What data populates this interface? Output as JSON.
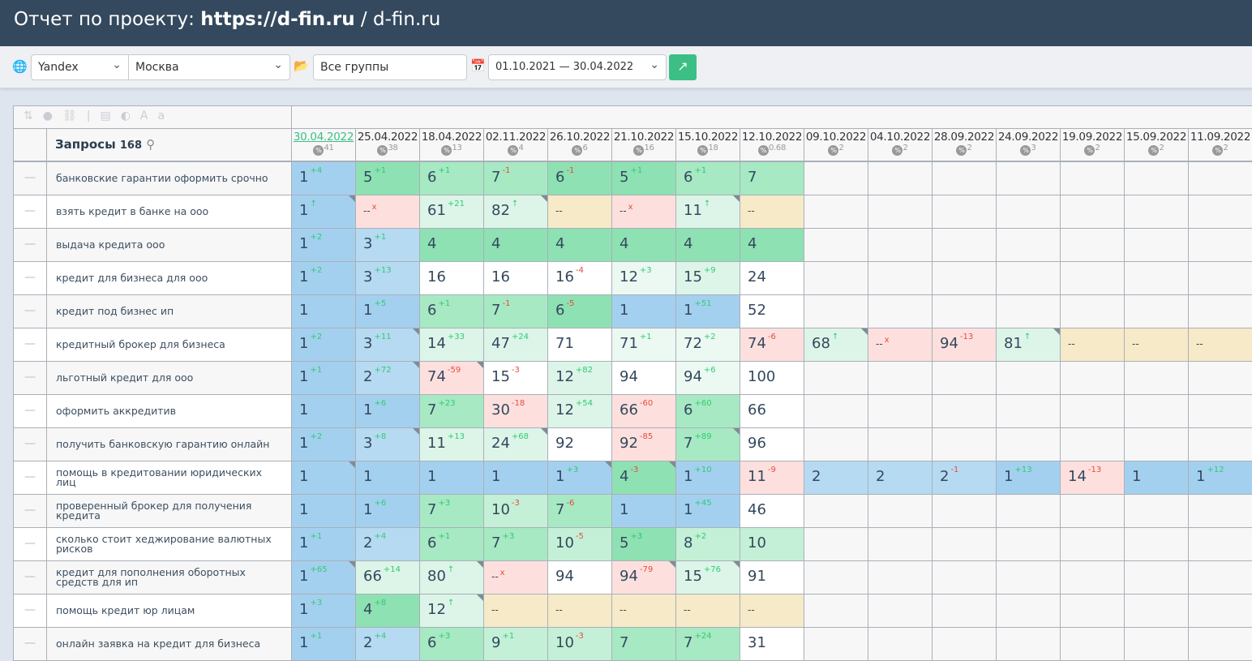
{
  "header": {
    "prefix": "Отчет по проекту: ",
    "project": "https://d-fin.ru",
    "suffix": " / d-fin.ru"
  },
  "filters": {
    "engine": "Yandex",
    "region": "Москва",
    "group": "Все группы",
    "date_range": "01.10.2021 — 30.04.2022"
  },
  "table": {
    "queries_label": "Запросы",
    "queries_count": "168",
    "dates": [
      {
        "date": "30.04.2022",
        "pct": "41"
      },
      {
        "date": "25.04.2022",
        "pct": "38"
      },
      {
        "date": "18.04.2022",
        "pct": "13"
      },
      {
        "date": "02.11.2022",
        "pct": "4"
      },
      {
        "date": "26.10.2022",
        "pct": "6"
      },
      {
        "date": "21.10.2022",
        "pct": "16"
      },
      {
        "date": "15.10.2022",
        "pct": "18"
      },
      {
        "date": "12.10.2022",
        "pct": "0.68"
      },
      {
        "date": "09.10.2022",
        "pct": "2"
      },
      {
        "date": "04.10.2022",
        "pct": "2"
      },
      {
        "date": "28.09.2022",
        "pct": "2"
      },
      {
        "date": "24.09.2022",
        "pct": "3"
      },
      {
        "date": "19.09.2022",
        "pct": "2"
      },
      {
        "date": "15.09.2022",
        "pct": "2"
      },
      {
        "date": "11.09.2022",
        "pct": "2"
      }
    ],
    "rows": [
      {
        "q": "банковские гарантии оформить срочно",
        "cells": [
          [
            "1",
            "+4",
            "b"
          ],
          [
            "5",
            "+1",
            "g1"
          ],
          [
            "6",
            "+1",
            "g2"
          ],
          [
            "7",
            "-1",
            "g2"
          ],
          [
            "6",
            "-1",
            "g1"
          ],
          [
            "5",
            "+1",
            "g1"
          ],
          [
            "6",
            "+1",
            "g2"
          ],
          [
            "7",
            "",
            "g2"
          ]
        ]
      },
      {
        "q": "взять кредит в банке на ооо",
        "cells": [
          [
            "1",
            "up",
            "b",
            1
          ],
          [
            "--",
            "x",
            "p"
          ],
          [
            "61",
            "+21",
            "g4"
          ],
          [
            "82",
            "up",
            "g4",
            1
          ],
          [
            "--",
            "",
            "y"
          ],
          [
            "--",
            "x",
            "p"
          ],
          [
            "11",
            "up",
            "g4",
            1
          ],
          [
            "--",
            "",
            "y"
          ]
        ]
      },
      {
        "q": "выдача кредита ооо",
        "cells": [
          [
            "1",
            "+2",
            "b"
          ],
          [
            "3",
            "+1",
            "lb"
          ],
          [
            "4",
            "",
            "g1"
          ],
          [
            "4",
            "",
            "g1"
          ],
          [
            "4",
            "",
            "g1"
          ],
          [
            "4",
            "",
            "g1"
          ],
          [
            "4",
            "",
            "g1"
          ],
          [
            "4",
            "",
            "g1"
          ]
        ]
      },
      {
        "q": "кредит для бизнеса для ооо",
        "cells": [
          [
            "1",
            "+2",
            "b"
          ],
          [
            "3",
            "+13",
            "lb"
          ],
          [
            "16",
            "",
            "w"
          ],
          [
            "16",
            "",
            "w"
          ],
          [
            "16",
            "-4",
            "w"
          ],
          [
            "12",
            "+3",
            "g5"
          ],
          [
            "15",
            "+9",
            "g4"
          ],
          [
            "24",
            "",
            "w"
          ]
        ]
      },
      {
        "q": "кредит под бизнес ип",
        "cells": [
          [
            "1",
            "",
            "b"
          ],
          [
            "1",
            "+5",
            "b"
          ],
          [
            "6",
            "+1",
            "g2"
          ],
          [
            "7",
            "-1",
            "g2"
          ],
          [
            "6",
            "-5",
            "g1"
          ],
          [
            "1",
            "",
            "b"
          ],
          [
            "1",
            "+51",
            "b"
          ],
          [
            "52",
            "",
            "w"
          ]
        ]
      },
      {
        "q": "кредитный брокер для бизнеса",
        "cells": [
          [
            "1",
            "+2",
            "b"
          ],
          [
            "3",
            "+11",
            "lb",
            1
          ],
          [
            "14",
            "+33",
            "g4"
          ],
          [
            "47",
            "+24",
            "g4"
          ],
          [
            "71",
            "",
            "w"
          ],
          [
            "71",
            "+1",
            "g5"
          ],
          [
            "72",
            "+2",
            "g5"
          ],
          [
            "74",
            "-6",
            "p"
          ],
          [
            "68",
            "up",
            "g4",
            1
          ],
          [
            "--",
            "x",
            "p"
          ],
          [
            "94",
            "-13",
            "p"
          ],
          [
            "81",
            "up",
            "g4",
            1
          ],
          [
            "--",
            "",
            "y"
          ],
          [
            "--",
            "",
            "y"
          ],
          [
            "--",
            "",
            "y"
          ]
        ]
      },
      {
        "q": "льготный кредит для ооо",
        "cells": [
          [
            "1",
            "+1",
            "b"
          ],
          [
            "2",
            "+72",
            "lb",
            1
          ],
          [
            "74",
            "-59",
            "p",
            1
          ],
          [
            "15",
            "-3",
            "w"
          ],
          [
            "12",
            "+82",
            "g4"
          ],
          [
            "94",
            "",
            "w"
          ],
          [
            "94",
            "+6",
            "g5"
          ],
          [
            "100",
            "",
            "w"
          ]
        ]
      },
      {
        "q": "оформить аккредитив",
        "cells": [
          [
            "1",
            "",
            "b"
          ],
          [
            "1",
            "+6",
            "b"
          ],
          [
            "7",
            "+23",
            "g2"
          ],
          [
            "30",
            "-18",
            "p"
          ],
          [
            "12",
            "+54",
            "g4"
          ],
          [
            "66",
            "-60",
            "p"
          ],
          [
            "6",
            "+60",
            "g2"
          ],
          [
            "66",
            "",
            "w"
          ]
        ]
      },
      {
        "q": "получить банковскую гарантию онлайн",
        "cells": [
          [
            "1",
            "+2",
            "b"
          ],
          [
            "3",
            "+8",
            "lb",
            1
          ],
          [
            "11",
            "+13",
            "g4"
          ],
          [
            "24",
            "+68",
            "g4",
            1
          ],
          [
            "92",
            "",
            "w"
          ],
          [
            "92",
            "-85",
            "p"
          ],
          [
            "7",
            "+89",
            "g2",
            1
          ],
          [
            "96",
            "",
            "w"
          ]
        ]
      },
      {
        "q": "помощь в кредитовании юридических лиц",
        "cells": [
          [
            "1",
            "",
            "b",
            1
          ],
          [
            "1",
            "",
            "b"
          ],
          [
            "1",
            "",
            "b"
          ],
          [
            "1",
            "",
            "b"
          ],
          [
            "1",
            "+3",
            "b",
            1
          ],
          [
            "4",
            "-3",
            "g1",
            1
          ],
          [
            "1",
            "+10",
            "b"
          ],
          [
            "11",
            "-9",
            "p"
          ],
          [
            "2",
            "",
            "lb"
          ],
          [
            "2",
            "",
            "lb"
          ],
          [
            "2",
            "-1",
            "lb"
          ],
          [
            "1",
            "+13",
            "b"
          ],
          [
            "14",
            "-13",
            "p"
          ],
          [
            "1",
            "",
            "b"
          ],
          [
            "1",
            "+12",
            "b"
          ]
        ]
      },
      {
        "q": "проверенный брокер для получения кредита",
        "cells": [
          [
            "1",
            "",
            "b"
          ],
          [
            "1",
            "+6",
            "b"
          ],
          [
            "7",
            "+3",
            "g2"
          ],
          [
            "10",
            "-3",
            "g3"
          ],
          [
            "7",
            "-6",
            "g2"
          ],
          [
            "1",
            "",
            "b"
          ],
          [
            "1",
            "+45",
            "b"
          ],
          [
            "46",
            "",
            "w"
          ]
        ]
      },
      {
        "q": "сколько стоит хеджирование валютных рисков",
        "cells": [
          [
            "1",
            "+1",
            "b"
          ],
          [
            "2",
            "+4",
            "lb"
          ],
          [
            "6",
            "+1",
            "g2"
          ],
          [
            "7",
            "+3",
            "g2"
          ],
          [
            "10",
            "-5",
            "g3"
          ],
          [
            "5",
            "+3",
            "g1"
          ],
          [
            "8",
            "+2",
            "g3"
          ],
          [
            "10",
            "",
            "g3"
          ]
        ]
      },
      {
        "q": "кредит для пополнения оборотных средств для ип",
        "cells": [
          [
            "1",
            "+65",
            "b",
            1
          ],
          [
            "66",
            "+14",
            "g4"
          ],
          [
            "80",
            "up",
            "g4",
            1
          ],
          [
            "--",
            "x",
            "p"
          ],
          [
            "94",
            "",
            "w"
          ],
          [
            "94",
            "-79",
            "p",
            1
          ],
          [
            "15",
            "+76",
            "g4",
            1
          ],
          [
            "91",
            "",
            "w"
          ]
        ]
      },
      {
        "q": "помощь кредит юр лицам",
        "cells": [
          [
            "1",
            "+3",
            "b"
          ],
          [
            "4",
            "+8",
            "g1"
          ],
          [
            "12",
            "up",
            "g4",
            1
          ],
          [
            "--",
            "",
            "y"
          ],
          [
            "--",
            "",
            "y"
          ],
          [
            "--",
            "",
            "y"
          ],
          [
            "--",
            "",
            "y"
          ],
          [
            "--",
            "",
            "y"
          ]
        ]
      },
      {
        "q": "онлайн заявка на кредит для бизнеса",
        "cells": [
          [
            "1",
            "+1",
            "b"
          ],
          [
            "2",
            "+4",
            "lb"
          ],
          [
            "6",
            "+3",
            "g2"
          ],
          [
            "9",
            "+1",
            "g3"
          ],
          [
            "10",
            "-3",
            "g3"
          ],
          [
            "7",
            "",
            "g2"
          ],
          [
            "7",
            "+24",
            "g2"
          ],
          [
            "31",
            "",
            "w"
          ]
        ]
      }
    ]
  }
}
